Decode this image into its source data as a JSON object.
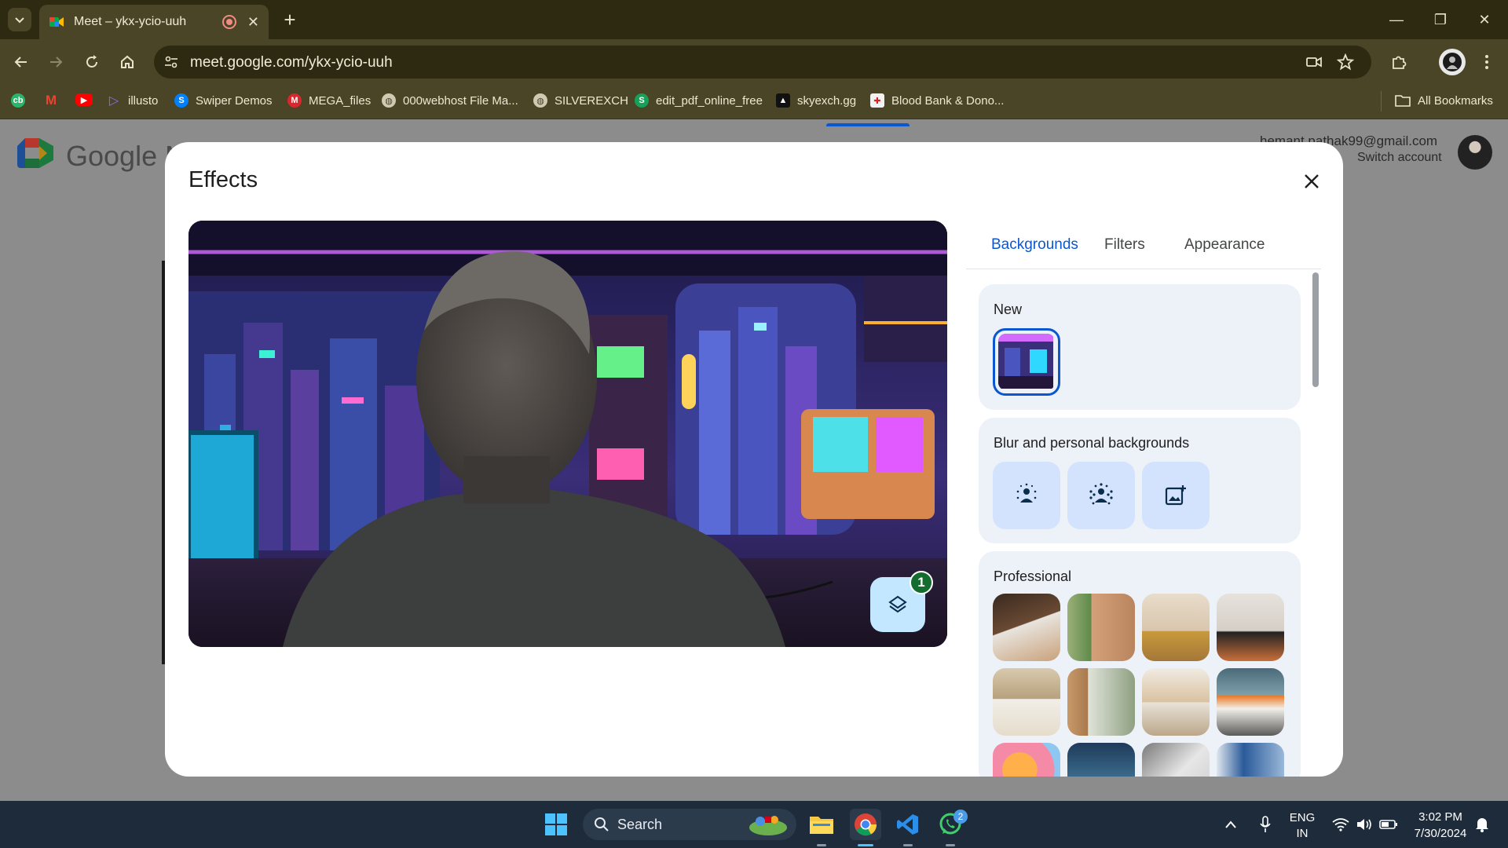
{
  "browser": {
    "tab_title": "Meet – ykx-ycio-uuh",
    "url": "meet.google.com/ykx-ycio-uuh",
    "bookmarks": [
      {
        "label": "",
        "icon": "cb-icon"
      },
      {
        "label": "",
        "icon": "gmail-icon"
      },
      {
        "label": "",
        "icon": "youtube-icon"
      },
      {
        "label": "illusto",
        "icon": "illusto-icon"
      },
      {
        "label": "Swiper Demos",
        "icon": "swiper-icon"
      },
      {
        "label": "MEGA_files",
        "icon": "mega-icon"
      },
      {
        "label": "000webhost File Ma...",
        "icon": "globe-icon"
      },
      {
        "label": "SILVEREXCH",
        "icon": "globe-icon"
      },
      {
        "label": "edit_pdf_online_free",
        "icon": "s-icon"
      },
      {
        "label": "skyexch.gg",
        "icon": "sky-icon"
      },
      {
        "label": "Blood Bank & Dono...",
        "icon": "bloodbank-icon"
      }
    ],
    "all_bookmarks": "All Bookmarks"
  },
  "page": {
    "logo_text": "Google M",
    "account_email": "hemant.pathak99@gmail.com",
    "switch_account": "Switch account"
  },
  "dialog": {
    "title": "Effects",
    "tabs": [
      "Backgrounds",
      "Filters",
      "Appearance"
    ],
    "active_tab": "Backgrounds",
    "effects_count": "1",
    "sections": {
      "new": "New",
      "blur": "Blur and personal backgrounds",
      "professional": "Professional"
    }
  },
  "taskbar": {
    "search": "Search",
    "lang_line1": "ENG",
    "lang_line2": "IN",
    "time": "3:02 PM",
    "date": "7/30/2024",
    "whatsapp_badge": "2"
  },
  "colors": {
    "accent": "#0b57d0",
    "tab_bar": "#2e2a12",
    "toolbar": "#4a4527",
    "taskbar": "#1d2b3a"
  }
}
